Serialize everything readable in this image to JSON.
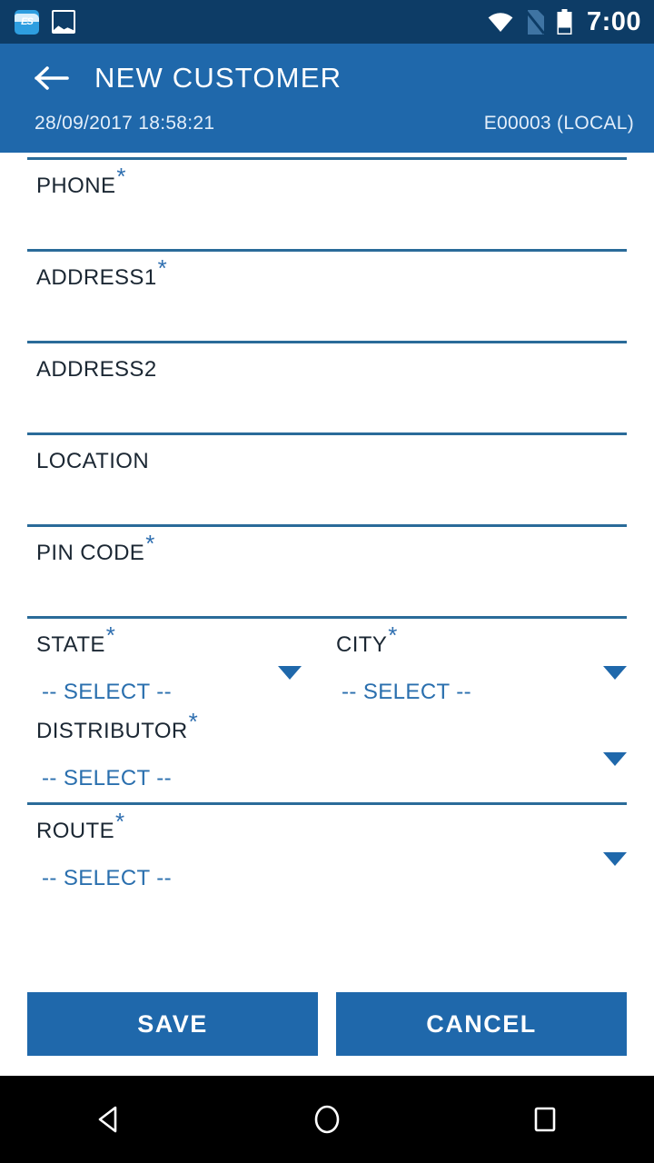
{
  "status_bar": {
    "time": "7:00",
    "left_icons": [
      {
        "name": "es-file-explorer-icon",
        "label": "ES"
      },
      {
        "name": "photo-icon",
        "label": ""
      }
    ],
    "right_icons": [
      {
        "name": "wifi-icon"
      },
      {
        "name": "no-sim-icon"
      },
      {
        "name": "battery-icon"
      }
    ]
  },
  "app_bar": {
    "back_label": "",
    "title": "NEW CUSTOMER",
    "datetime": "28/09/2017  18:58:21",
    "record_id": "E00003  (LOCAL)"
  },
  "form": {
    "required_mark": "*",
    "fields": [
      {
        "label": "PHONE",
        "required": true,
        "value": "",
        "type": "text"
      },
      {
        "label": "ADDRESS1",
        "required": true,
        "value": "",
        "type": "text"
      },
      {
        "label": "ADDRESS2",
        "required": false,
        "value": "",
        "type": "text"
      },
      {
        "label": "LOCATION",
        "required": false,
        "value": "",
        "type": "text"
      },
      {
        "label": "PIN CODE",
        "required": true,
        "value": "",
        "type": "text"
      }
    ],
    "dropdown_row": [
      {
        "label": "STATE",
        "required": true,
        "value": "-- SELECT --"
      },
      {
        "label": "CITY",
        "required": true,
        "value": "-- SELECT --"
      }
    ],
    "dropdowns": [
      {
        "label": "DISTRIBUTOR",
        "required": true,
        "value": "-- SELECT --"
      },
      {
        "label": "ROUTE",
        "required": true,
        "value": "-- SELECT --"
      }
    ]
  },
  "actions": {
    "save_label": "SAVE",
    "cancel_label": "CANCEL"
  },
  "nav_bar": {
    "back": "back-triangle-icon",
    "home": "home-circle-icon",
    "recents": "recents-square-icon"
  },
  "colors": {
    "status_bar": "#0d3c66",
    "app_bar": "#1f68ab",
    "accent": "#1f68ab",
    "rule": "#2a6b99",
    "label": "#1b2733",
    "select_text": "#2a6fae",
    "nav_bar": "#000000"
  }
}
